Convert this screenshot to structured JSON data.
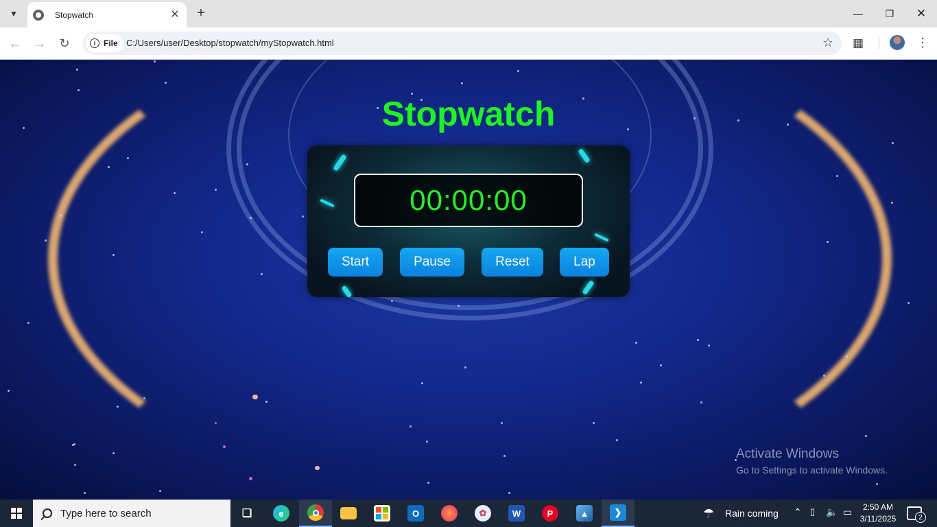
{
  "browser": {
    "tab_title": "Stopwatch",
    "file_chip": "File",
    "url": "C:/Users/user/Desktop/stopwatch/myStopwatch.html"
  },
  "page": {
    "heading": "Stopwatch",
    "display_time": "00:00:00",
    "buttons": {
      "start": "Start",
      "pause": "Pause",
      "reset": "Reset",
      "lap": "Lap"
    },
    "colors": {
      "heading": "#1ef51e",
      "time": "#1ef51e",
      "button": "#0a82e0"
    }
  },
  "watermark": {
    "title": "Activate Windows",
    "subtitle": "Go to Settings to activate Windows."
  },
  "taskbar": {
    "search_placeholder": "Type here to search",
    "weather": "Rain coming",
    "time": "2:50 AM",
    "date": "3/11/2025",
    "notification_count": "2",
    "apps": [
      "task-view",
      "edge",
      "chrome",
      "file-explorer",
      "microsoft-store",
      "outlook",
      "firefox",
      "paint",
      "word",
      "pinterest",
      "photos",
      "vscode"
    ]
  }
}
